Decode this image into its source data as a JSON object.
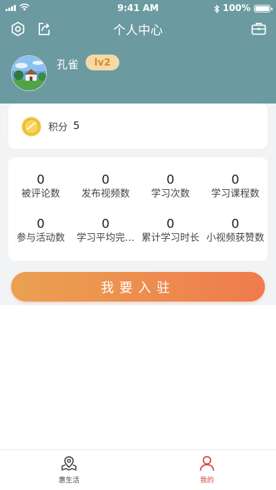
{
  "status_bar": {
    "time": "9:41 AM",
    "battery": "100%",
    "battery_level": 1.0
  },
  "nav": {
    "title": "个人中心"
  },
  "profile": {
    "name": "孔雀",
    "level": "lv2"
  },
  "points": {
    "label": "积分",
    "value": "5"
  },
  "stats": [
    {
      "value": "0",
      "label": "被评论数"
    },
    {
      "value": "0",
      "label": "发布视频数"
    },
    {
      "value": "0",
      "label": "学习次数"
    },
    {
      "value": "0",
      "label": "学习课程数"
    },
    {
      "value": "0",
      "label": "参与活动数"
    },
    {
      "value": "0",
      "label": "学习平均完…"
    },
    {
      "value": "0",
      "label": "累计学习时长"
    },
    {
      "value": "0",
      "label": "小视频获赞数"
    }
  ],
  "join_button": {
    "label": "我要入驻"
  },
  "tabs": [
    {
      "label": "惠生活",
      "icon": "map-pin-icon",
      "active": false
    },
    {
      "label": "我的",
      "icon": "user-icon",
      "active": true
    }
  ],
  "colors": {
    "header_bg": "#6b9aa0",
    "accent_orange": "#ef7b4d",
    "badge_text": "#d68a2c",
    "tab_active": "#d9413e"
  }
}
